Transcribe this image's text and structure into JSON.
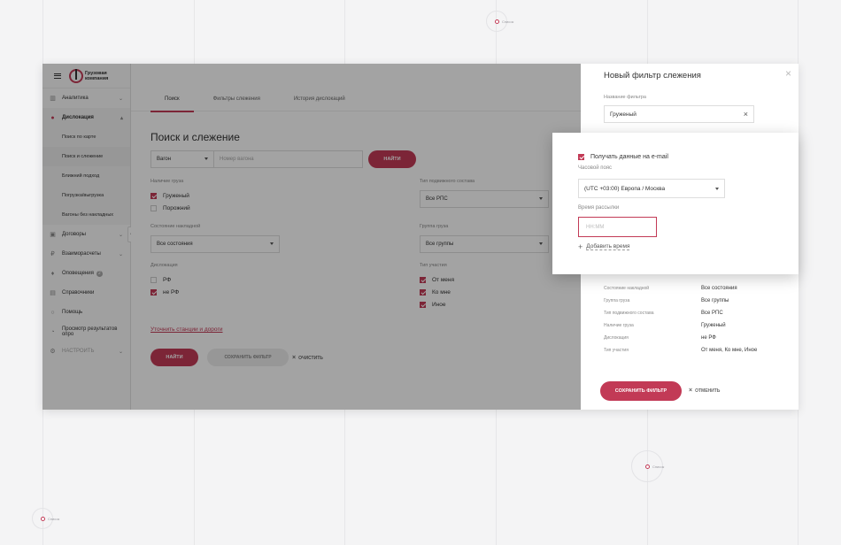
{
  "background_hints": [
    "Список",
    "Список",
    "Список"
  ],
  "brand": {
    "logo_text": "Грузовая компания",
    "accent": "#c23a56"
  },
  "sidebar": {
    "items": [
      {
        "label": "Аналитика",
        "icon": "analytics-icon"
      },
      {
        "label": "Дислокация",
        "icon": "location-pin-icon"
      },
      {
        "label": "Договоры",
        "icon": "contract-icon"
      },
      {
        "label": "Взаиморасчеты",
        "icon": "settlement-icon"
      },
      {
        "label": "Оповещения",
        "icon": "bell-icon",
        "badge": "2"
      },
      {
        "label": "Справочники",
        "icon": "book-icon"
      },
      {
        "label": "Помощь",
        "icon": "help-icon"
      },
      {
        "label": "Просмотр результатов опро",
        "icon": "survey-icon"
      },
      {
        "label": "НАСТРОИТЬ",
        "icon": "settings-icon"
      }
    ],
    "sub_items": [
      "Поиск по карте",
      "Поиск и слежение",
      "Ближний подход",
      "Погрузка/выгрузка",
      "Вагоны без накладных"
    ]
  },
  "main": {
    "tabs": [
      "Поиск",
      "Фильтры слежения",
      "История дислокаций"
    ],
    "title": "Поиск и слежение",
    "search_type": "Вагон",
    "search_placeholder": "Номер вагона",
    "find_label": "НАЙТИ",
    "cargo_label": "Наличие груза",
    "cargo_options": [
      {
        "label": "Груженый",
        "checked": true
      },
      {
        "label": "Порожний",
        "checked": false
      }
    ],
    "waybill_label": "Состояние накладной",
    "waybill_value": "Все состояния",
    "disloc_label": "Дислокация",
    "disloc_options": [
      {
        "label": "РФ",
        "checked": false
      },
      {
        "label": "не РФ",
        "checked": true
      }
    ],
    "rolling_label": "Тип подвижного состава",
    "rolling_value": "Все РПС",
    "group_label": "Группа груза",
    "group_value": "Все группы",
    "part_label": "Тип участия",
    "part_options": [
      {
        "label": "От меня",
        "checked": true
      },
      {
        "label": "Ко мне",
        "checked": true
      },
      {
        "label": "Иное",
        "checked": true
      }
    ],
    "refine_link": "Уточнить станции и дороги",
    "find_label2": "НАЙТИ",
    "save_filter_label": "СОХРАНИТЬ ФИЛЬТР",
    "clear_label": "ОЧИСТИТЬ"
  },
  "panel": {
    "title": "Новый фильтр слежения",
    "name_label": "Название фильтра",
    "name_value": "Груженый",
    "summary": [
      {
        "k": "Состояние накладной",
        "v": "Все состояния"
      },
      {
        "k": "Группа груза",
        "v": "Все группы"
      },
      {
        "k": "Тип подвижного состава",
        "v": "Все РПС"
      },
      {
        "k": "Наличие груза",
        "v": "Груженый"
      },
      {
        "k": "Дислокация",
        "v": "не РФ"
      },
      {
        "k": "Тип участия",
        "v": "От меня, Ко мне, Иное"
      }
    ],
    "save_label": "СОХРАНИТЬ ФИЛЬТР",
    "cancel_label": "ОТМЕНИТЬ"
  },
  "popup": {
    "email_label": "Получать данные на e-mail",
    "email_checked": true,
    "tz_label": "Часовой пояс",
    "tz_value": "(UTC +03:00) Европа / Москва",
    "time_label": "Время рассылки",
    "time_placeholder": "НН:ММ",
    "add_time_label": "Добавить время"
  }
}
